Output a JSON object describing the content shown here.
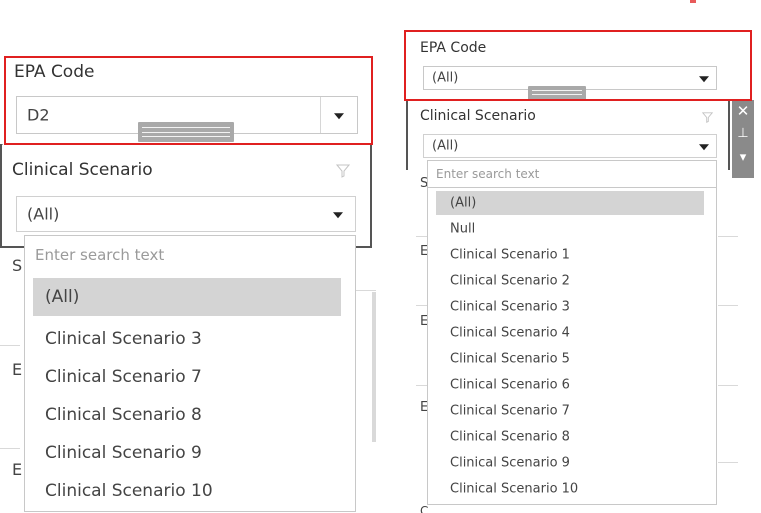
{
  "left": {
    "epa_code": {
      "label": "EPA Code",
      "value": "D2"
    },
    "clinical_scenario": {
      "label": "Clinical Scenario",
      "value": "(All)",
      "search_placeholder": "Enter search text",
      "options": [
        "(All)",
        "Clinical Scenario 3",
        "Clinical Scenario 7",
        "Clinical Scenario 8",
        "Clinical Scenario 9",
        "Clinical Scenario 10"
      ],
      "selected_index": 0
    }
  },
  "right": {
    "epa_code": {
      "label": "EPA Code",
      "value": "(All)"
    },
    "clinical_scenario": {
      "label": "Clinical Scenario",
      "value": "(All)",
      "search_placeholder": "Enter search text",
      "options": [
        "(All)",
        "Null",
        "Clinical Scenario 1",
        "Clinical Scenario 2",
        "Clinical Scenario 3",
        "Clinical Scenario 4",
        "Clinical Scenario 5",
        "Clinical Scenario 6",
        "Clinical Scenario 7",
        "Clinical Scenario 8",
        "Clinical Scenario 9",
        "Clinical Scenario 10"
      ],
      "selected_index": 0
    },
    "side_toolbar": {
      "close_glyph": "✕",
      "pin_glyph": "⊥",
      "menu_glyph": "▾"
    }
  },
  "colors": {
    "highlight": "#e02020",
    "selected_row": "#d4d4d4",
    "accent_mark": "#e85a5a"
  },
  "icons": [
    "dropdown-arrow-icon",
    "filter-funnel-icon",
    "close-icon",
    "pin-icon",
    "menu-arrow-icon",
    "drag-handle-icon"
  ]
}
